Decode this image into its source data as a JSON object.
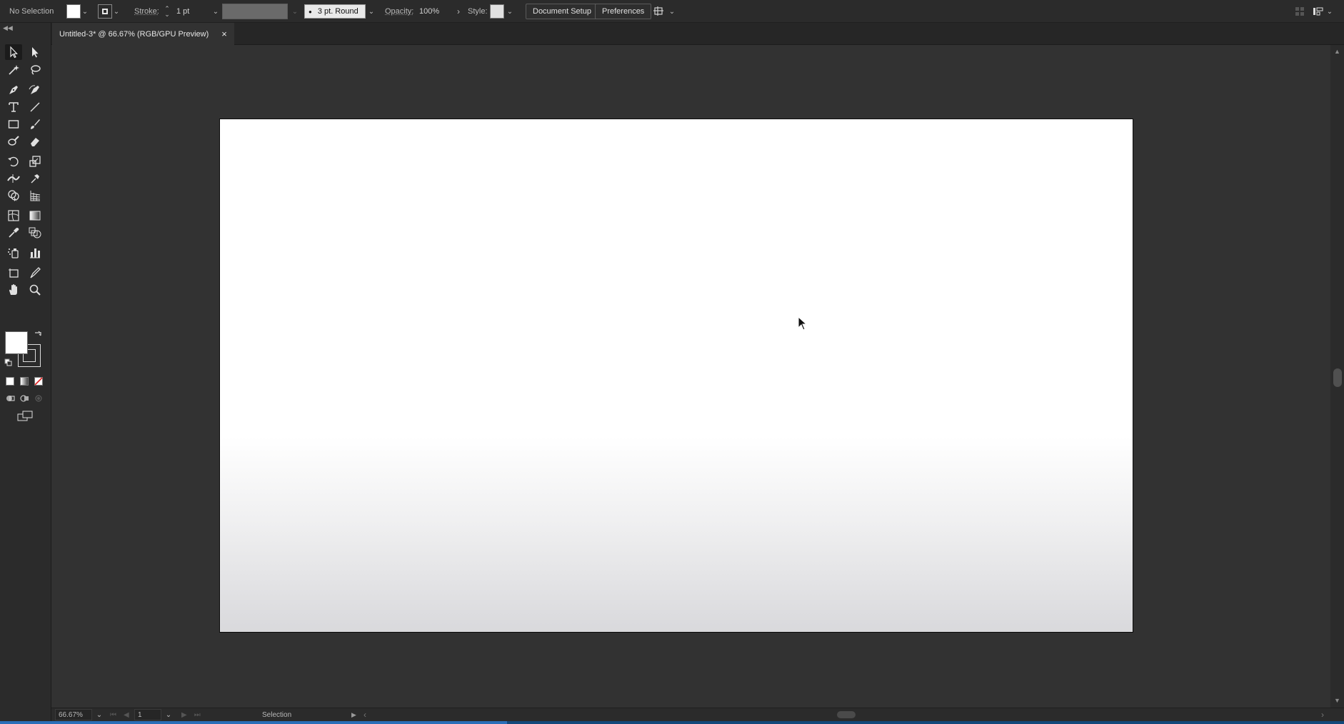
{
  "control_bar": {
    "selection_status": "No Selection",
    "stroke_label": "Stroke:",
    "stroke_weight": "1 pt",
    "brush_label": "3 pt. Round",
    "opacity_label": "Opacity:",
    "opacity_value": "100%",
    "style_label": "Style:",
    "document_setup_button": "Document Setup",
    "preferences_button": "Preferences"
  },
  "document_tab": {
    "title": "Untitled-3* @ 66.67% (RGB/GPU Preview)",
    "close": "×"
  },
  "tools": [
    "selection-tool",
    "direct-selection-tool",
    "magic-wand-tool",
    "lasso-tool",
    "pen-tool",
    "curvature-tool",
    "type-tool",
    "line-segment-tool",
    "rectangle-tool",
    "paintbrush-tool",
    "shaper-tool",
    "eraser-tool",
    "rotate-tool",
    "scale-tool",
    "width-tool",
    "puppet-warp-tool",
    "shape-builder-tool",
    "perspective-grid-tool",
    "mesh-tool",
    "gradient-tool",
    "eyedropper-tool",
    "blend-tool",
    "symbol-sprayer-tool",
    "column-graph-tool",
    "artboard-tool",
    "slice-tool",
    "hand-tool",
    "zoom-tool"
  ],
  "colors": {
    "fill": "#ffffff",
    "ui_background": "#323232",
    "panel": "#2b2b2b",
    "artboard_bottom": "#d9d9dc"
  },
  "status_bar": {
    "zoom": "66.67%",
    "artboard_number": "1",
    "current_tool": "Selection"
  }
}
